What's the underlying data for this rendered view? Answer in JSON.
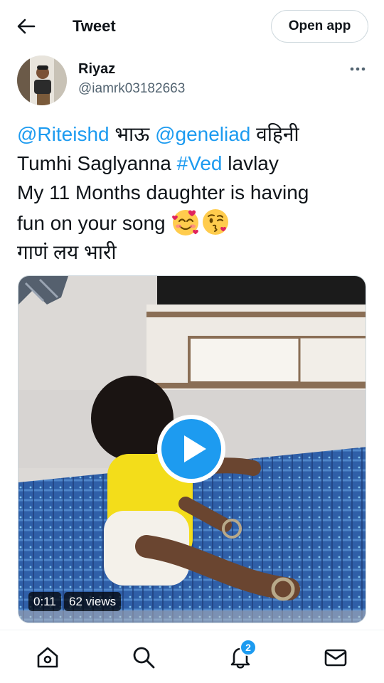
{
  "header": {
    "back_icon": "back-arrow-icon",
    "title": "Tweet",
    "open_app_label": "Open app"
  },
  "author": {
    "name": "Riyaz",
    "handle": "@iamrk03182663",
    "more_icon": "more-horizontal-icon"
  },
  "tweet": {
    "line1": {
      "mention1": "@Riteishd",
      "text1": " भाऊ ",
      "mention2": "@geneliad",
      "text2": " वहिनी"
    },
    "line2": {
      "text1": "Tumhi Saglyanna ",
      "hashtag": "#Ved",
      "text2": " lavlay"
    },
    "line3": {
      "text": "My 11 Months daughter is having"
    },
    "line4": {
      "text": "fun on your song ",
      "emoji1": "smiling-face-with-hearts",
      "emoji2": "face-blowing-kiss"
    },
    "line5": {
      "text": "गाणं लय भारी"
    }
  },
  "media": {
    "duration": "0:11",
    "views": "62 views",
    "play_icon": "play-icon"
  },
  "bottom_nav": {
    "home_icon": "home-icon",
    "search_icon": "search-icon",
    "notifications_icon": "bell-icon",
    "notifications_count": "2",
    "messages_icon": "mail-icon"
  },
  "colors": {
    "accent": "#1d9bf0",
    "text": "#0f1419",
    "secondary_text": "#536471",
    "border": "#cfd9de"
  }
}
